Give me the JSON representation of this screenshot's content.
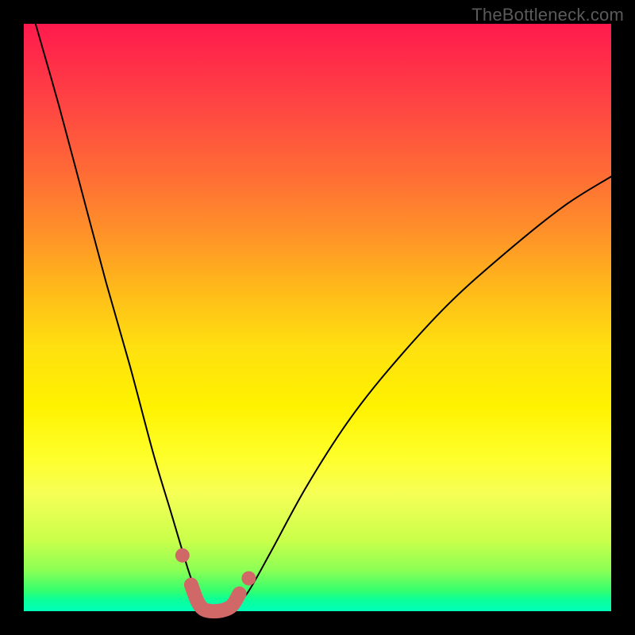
{
  "watermark": "TheBottleneck.com",
  "chart_data": {
    "type": "line",
    "title": "",
    "xlabel": "",
    "ylabel": "",
    "xlim": [
      0,
      1
    ],
    "ylim": [
      0,
      1
    ],
    "grid": false,
    "series": [
      {
        "name": "bottleneck-curve",
        "color": "#000000",
        "x": [
          0.02,
          0.06,
          0.1,
          0.14,
          0.18,
          0.22,
          0.25,
          0.28,
          0.295,
          0.31,
          0.33,
          0.35,
          0.38,
          0.42,
          0.48,
          0.55,
          0.62,
          0.72,
          0.82,
          0.92,
          1.0
        ],
        "y": [
          1.0,
          0.86,
          0.71,
          0.56,
          0.42,
          0.27,
          0.17,
          0.07,
          0.03,
          0.0,
          0.0,
          0.0,
          0.03,
          0.1,
          0.21,
          0.32,
          0.41,
          0.52,
          0.61,
          0.69,
          0.74
        ]
      },
      {
        "name": "optimum-marker",
        "color": "#d06868",
        "x": [
          0.285,
          0.295,
          0.305,
          0.32,
          0.34,
          0.355,
          0.367
        ],
        "y": [
          0.045,
          0.018,
          0.004,
          0.0,
          0.002,
          0.01,
          0.03
        ]
      }
    ],
    "annotations": [
      {
        "name": "optimum-dot-start",
        "x": 0.27,
        "y": 0.095,
        "color": "#d06868"
      },
      {
        "name": "optimum-dot-end",
        "x": 0.383,
        "y": 0.056,
        "color": "#d06868"
      }
    ],
    "background": {
      "type": "vertical-gradient",
      "stops": [
        {
          "offset": 0.0,
          "color": "#ff1a4d"
        },
        {
          "offset": 0.65,
          "color": "#fff200"
        },
        {
          "offset": 1.0,
          "color": "#00ffb9"
        }
      ]
    }
  }
}
